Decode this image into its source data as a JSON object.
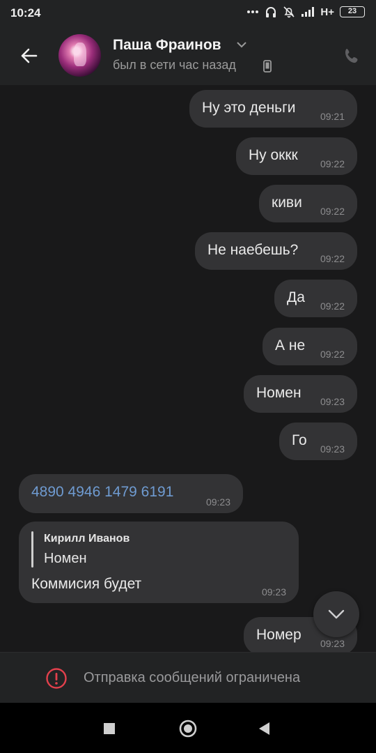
{
  "status_bar": {
    "time": "10:24",
    "network": "H+",
    "battery": "23"
  },
  "header": {
    "contact_name": "Паша Фраинов",
    "contact_status": "был в сети час назад"
  },
  "messages": [
    {
      "text": "Ну это деньги",
      "time": "09:21",
      "outgoing": true
    },
    {
      "text": "Ну оккк",
      "time": "09:22",
      "outgoing": true
    },
    {
      "text": "киви",
      "time": "09:22",
      "outgoing": true
    },
    {
      "text": "Не наебешь?",
      "time": "09:22",
      "outgoing": true
    },
    {
      "text": "Да",
      "time": "09:22",
      "outgoing": true
    },
    {
      "text": "А не",
      "time": "09:22",
      "outgoing": true
    },
    {
      "text": "Номен",
      "time": "09:23",
      "outgoing": true
    },
    {
      "text": "Го",
      "time": "09:23",
      "outgoing": true
    },
    {
      "text": "4890 4946 1479 6191",
      "time": "09:23",
      "outgoing": false
    },
    {
      "reply_author": "Кирилл Иванов",
      "reply_text": "Номен",
      "text": "Коммисия будет",
      "time": "09:23",
      "outgoing": false
    },
    {
      "text": "Номер",
      "time": "09:23",
      "outgoing": true
    }
  ],
  "restriction": {
    "text": "Отправка сообщений ограничена"
  },
  "icons": {
    "back": "arrow-left-icon",
    "call": "phone-icon",
    "scroll": "chevron-down-icon",
    "warning": "alert-circle-icon"
  },
  "colors": {
    "bubble": "#333335",
    "link": "#6f9bd1",
    "warning": "#e2404c"
  }
}
